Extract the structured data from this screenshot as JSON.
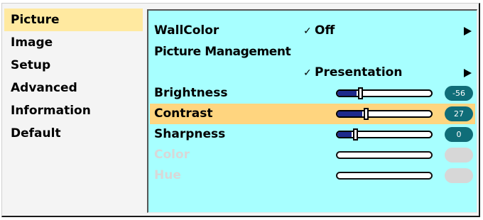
{
  "sidebar": {
    "items": [
      {
        "label": "Picture",
        "active": true
      },
      {
        "label": "Image",
        "active": false
      },
      {
        "label": "Setup",
        "active": false
      },
      {
        "label": "Advanced",
        "active": false
      },
      {
        "label": "Information",
        "active": false
      },
      {
        "label": "Default",
        "active": false
      }
    ]
  },
  "panel": {
    "wallcolor": {
      "label": "WallColor",
      "value": "Off"
    },
    "picture_management": {
      "label": "Picture Management",
      "value": "Presentation"
    },
    "check_mark": "✓",
    "adjustments": [
      {
        "label": "Brightness",
        "value": "-56",
        "level": 0.22,
        "enabled": true,
        "selected": false
      },
      {
        "label": "Contrast",
        "value": "27",
        "level": 0.28,
        "enabled": true,
        "selected": true
      },
      {
        "label": "Sharpness",
        "value": "0",
        "level": 0.17,
        "enabled": true,
        "selected": false
      },
      {
        "label": "Color",
        "value": "",
        "level": null,
        "enabled": false,
        "selected": false
      },
      {
        "label": "Hue",
        "value": "",
        "level": null,
        "enabled": false,
        "selected": false
      }
    ]
  },
  "colors": {
    "panel_background": "#a7ffff",
    "selected_highlight": "#ffd57f",
    "active_menu": "#ffe9a0",
    "value_badge": "#0f6d78",
    "slider_fill": "#1d2a8c",
    "disabled": "#d7d7d7"
  },
  "icons": {
    "submenu": "right-triangle-arrow",
    "check": "check-mark"
  }
}
